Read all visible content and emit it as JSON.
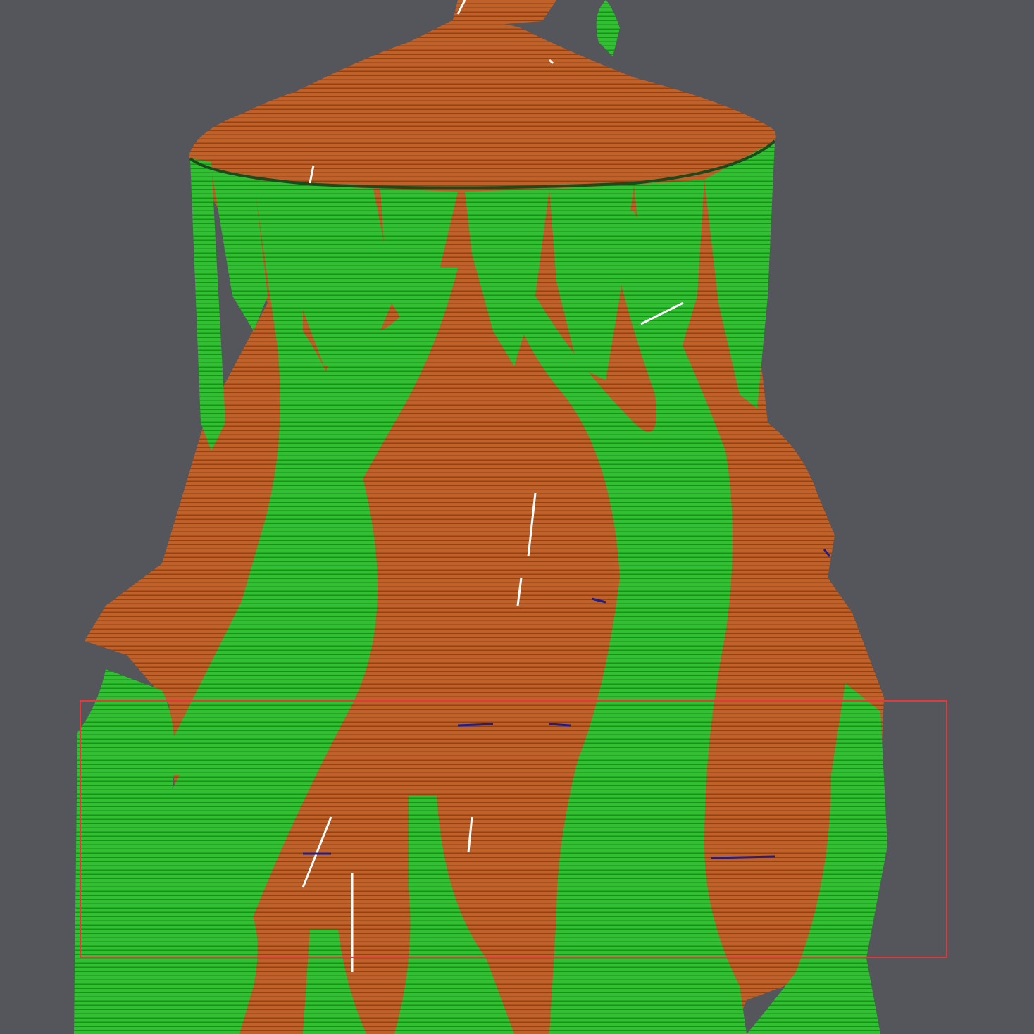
{
  "viewer": {
    "background": "#55555c",
    "model_color": "#c0612a",
    "support_color": "#2fbf2f",
    "seam_color": "#1d1d8c",
    "highlight_color": "#ffffff",
    "selection_color": "#e03a3a"
  }
}
